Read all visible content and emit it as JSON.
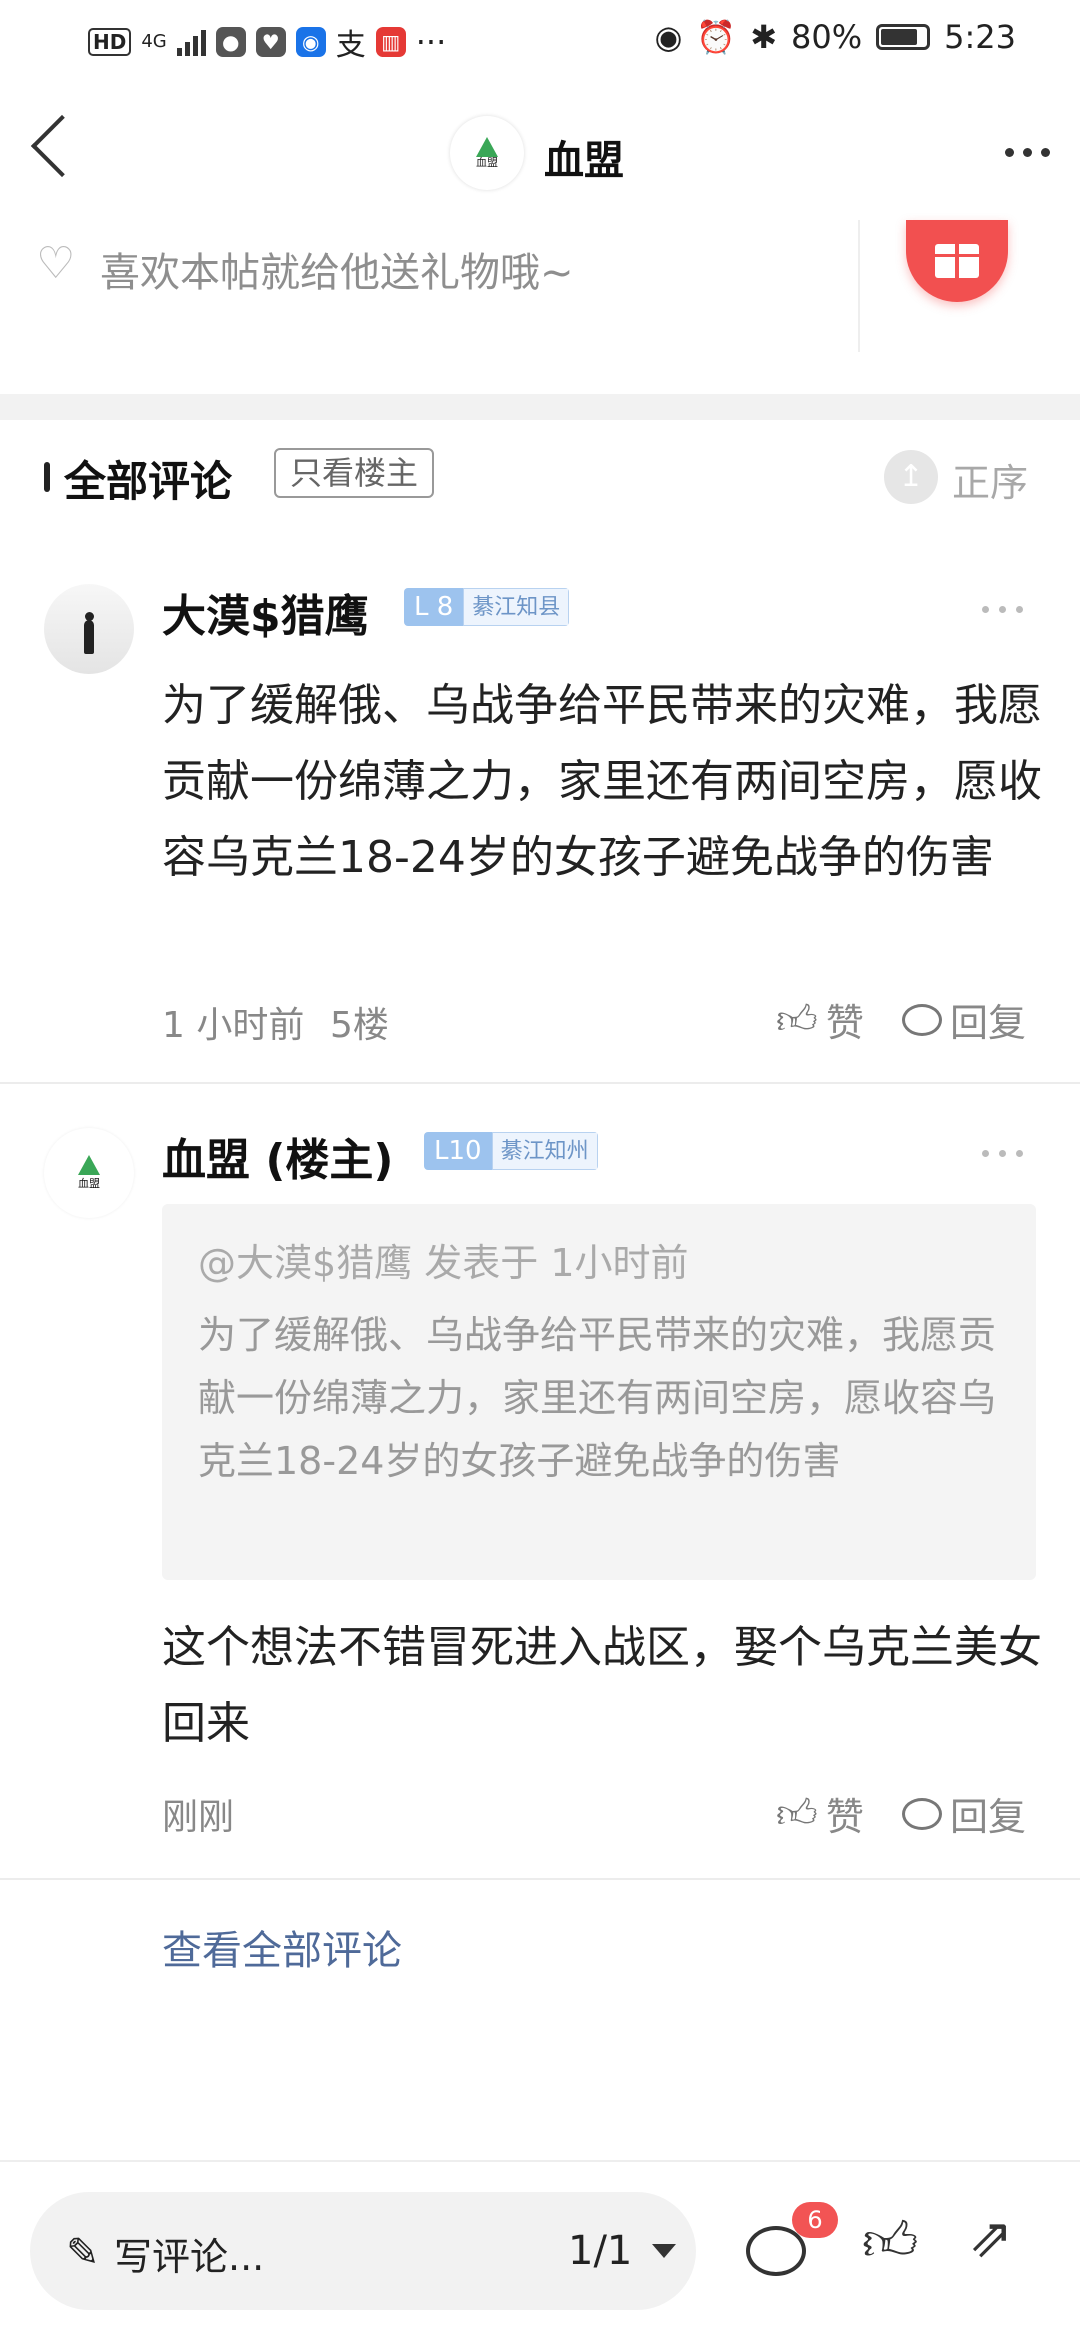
{
  "status_bar": {
    "time": "5:23",
    "battery": "80%",
    "network": "4G",
    "hd": "HD",
    "more": "···",
    "app_icon_text": "支"
  },
  "header": {
    "title": "血盟",
    "logo_text": "血盟"
  },
  "gift": {
    "hint": "喜欢本帖就给他送礼物哦~"
  },
  "comments_header": {
    "title": "全部评论",
    "filter": "只看楼主",
    "sort": "正序"
  },
  "comments": [
    {
      "user": "大漠$猎鹰",
      "level": "L 8",
      "title": "綦江知县",
      "text": "为了缓解俄、乌战争给平民带来的灾难，我愿贡献一份绵薄之力，家里还有两间空房，愿收容乌克兰18-24岁的女孩子避免战争的伤害",
      "time": "1 小时前",
      "floor": "5楼",
      "like_label": "赞",
      "reply_label": "回复"
    },
    {
      "user": "血盟 (楼主)",
      "level": "L10",
      "title": "綦江知州",
      "quote_head": "@大漠$猎鹰 发表于 1小时前",
      "quote_text": "为了缓解俄、乌战争给平民带来的灾难，我愿贡献一份绵薄之力，家里还有两间空房，愿收容乌克兰18-24岁的女孩子避免战争的伤害",
      "text": "这个想法不错冒死进入战区，娶个乌克兰美女回来",
      "time": "刚刚",
      "like_label": "赞",
      "reply_label": "回复"
    }
  ],
  "view_all": "查看全部评论",
  "bottom_bar": {
    "placeholder": "写评论...",
    "page": "1/1",
    "comment_count": "6"
  }
}
